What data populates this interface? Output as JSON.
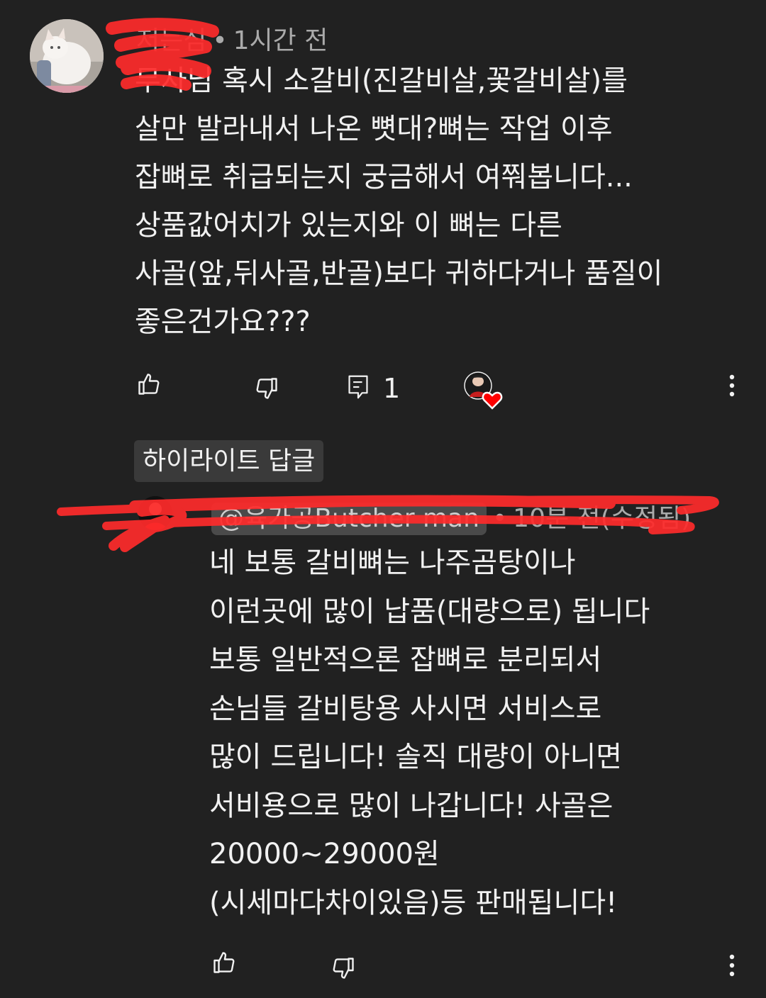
{
  "comments": [
    {
      "author": "저는심",
      "time": "1시간 전",
      "text": "무사님 혹시 소갈비(진갈비살,꽃갈비살)를\n살만 발라내서 나온 뼛대?뼈는 작업 이후\n잡뼈로 취급되는지 궁금해서 여쭤봅니다...\n상품값어치가 있는지와 이 뼈는 다른\n사골(앞,뒤사골,반골)보다 귀하다거나 품질이\n좋은건가요???",
      "reply_count": "1"
    },
    {
      "author": "@육가공Butcher man",
      "time": "10분 전(수정됨)",
      "text": "네 보통 갈비뼈는 나주곰탕이나\n이런곳에 많이 납품(대량으로) 됩니다\n보통 일반적으론 잡뼈로 분리되서\n손님들 갈비탕용  사시면 서비스로\n많이 드립니다! 솔직 대량이 아니면\n서비용으로 많이 나갑니다! 사골은\n20000~29000원\n(시세마다차이있음)등 판매됩니다!"
    }
  ],
  "highlight_badge": "하이라이트 답글",
  "icons": {
    "like": "thumb-up-icon",
    "dislike": "thumb-down-icon",
    "reply": "comment-icon",
    "more": "more-vert-icon",
    "heart": "creator-heart-icon"
  },
  "colors": {
    "background": "#212121",
    "text": "#f1f1f1",
    "secondary": "#aaaaaa",
    "heart": "#ff0000",
    "redaction": "#ff2b2b"
  }
}
